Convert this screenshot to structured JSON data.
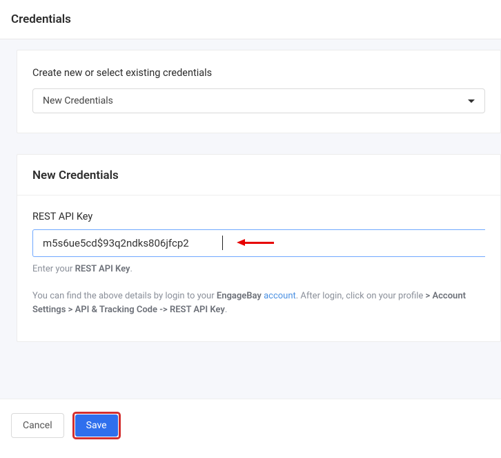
{
  "header": {
    "title": "Credentials"
  },
  "panel1": {
    "label": "Create new or select existing credentials",
    "select_value": "New Credentials"
  },
  "panel2": {
    "title": "New Credentials",
    "field_label": "REST API Key",
    "input_value": "m5s6ue5cd$93q2ndks806jfcp2",
    "helper_prefix": "Enter your ",
    "helper_bold": "REST API Key",
    "helper_suffix": ".",
    "desc_prefix": "You can find the above details by login to your ",
    "desc_bold1": "EngageBay",
    "desc_space": " ",
    "desc_link": "account",
    "desc_mid": ". After login, click on your profile ",
    "desc_bold2": "> Account Settings > API & Tracking Code -> REST API Key",
    "desc_end": "."
  },
  "footer": {
    "cancel_label": "Cancel",
    "save_label": "Save"
  }
}
